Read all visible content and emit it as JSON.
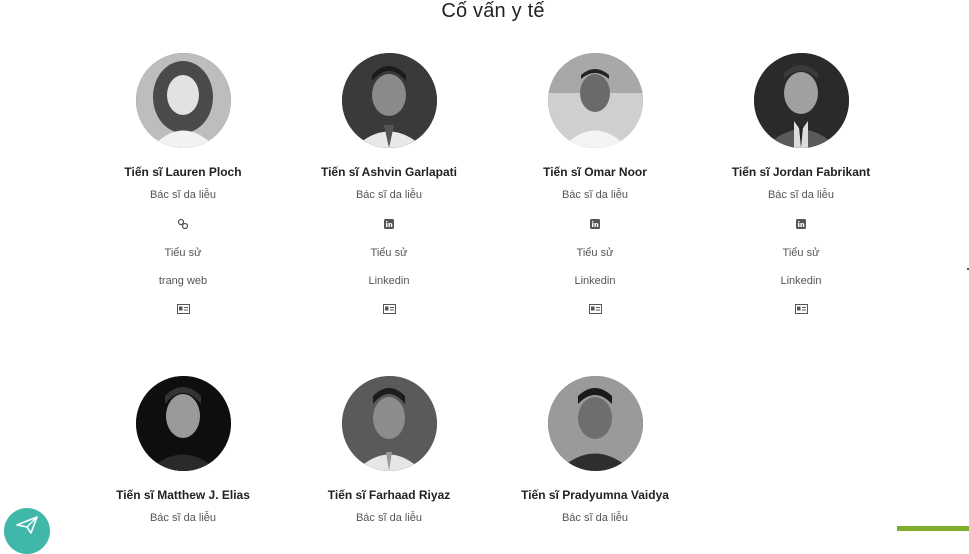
{
  "page": {
    "title": "Cố vấn y tế"
  },
  "advisors": [
    {
      "name": "Tiến sĩ Lauren Ploch",
      "role": "Bác sĩ da liễu",
      "link_icon": "link-icon",
      "bio_label": "Tiểu sử",
      "link_label": "trang web",
      "card_icon": "contact-card-icon"
    },
    {
      "name": "Tiến sĩ Ashvin Garlapati",
      "role": "Bác sĩ da liễu",
      "link_icon": "linkedin-icon",
      "bio_label": "Tiểu sử",
      "link_label": "Linkedin",
      "card_icon": "contact-card-icon"
    },
    {
      "name": "Tiến sĩ Omar Noor",
      "role": "Bác sĩ da liễu",
      "link_icon": "linkedin-icon",
      "bio_label": "Tiểu sử",
      "link_label": "Linkedin",
      "card_icon": "contact-card-icon"
    },
    {
      "name": "Tiến sĩ Jordan Fabrikant",
      "role": "Bác sĩ da liễu",
      "link_icon": "linkedin-icon",
      "bio_label": "Tiểu sử",
      "link_label": "Linkedin",
      "card_icon": "contact-card-icon"
    },
    {
      "name": "Tiến sĩ Matthew J. Elias",
      "role": "Bác sĩ da liễu"
    },
    {
      "name": "Tiến sĩ Farhaad Riyaz",
      "role": "Bác sĩ da liễu"
    },
    {
      "name": "Tiến sĩ Pradyumna Vaidya",
      "role": "Bác sĩ da liễu"
    }
  ],
  "colors": {
    "fab": "#3fb7a9",
    "green_tab": "#7fae2f"
  },
  "fab_icon": "paper-plane-icon"
}
